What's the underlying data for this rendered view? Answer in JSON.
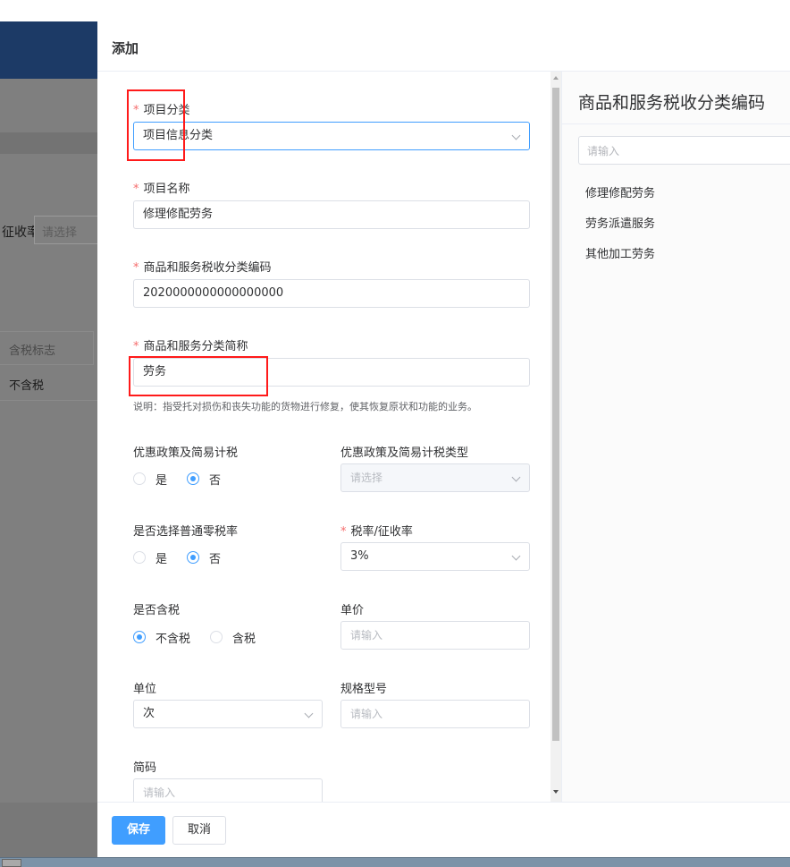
{
  "background": {
    "rate_label": "征收率",
    "rate_placeholder": "请选择",
    "table_header": "含税标志",
    "table_cell": "不含税"
  },
  "drawer": {
    "title": "添加",
    "form": {
      "category": {
        "label": "项目分类",
        "value": "项目信息分类"
      },
      "name": {
        "label": "项目名称",
        "value": "修理修配劳务"
      },
      "tax_code": {
        "label": "商品和服务税收分类编码",
        "value": "2020000000000000000"
      },
      "short_name": {
        "label": "商品和服务分类简称",
        "value": "劳务",
        "hint": "说明：指受托对损伤和丧失功能的货物进行修复，使其恢复原状和功能的业务。"
      },
      "preferential": {
        "label": "优惠政策及简易计税",
        "yes": "是",
        "no": "否",
        "selected": "否"
      },
      "preferential_type": {
        "label": "优惠政策及简易计税类型",
        "placeholder": "请选择"
      },
      "zero_rate": {
        "label": "是否选择普通零税率",
        "yes": "是",
        "no": "否",
        "selected": "否"
      },
      "tax_rate": {
        "label": "税率/征收率",
        "value": "3%"
      },
      "tax_included": {
        "label": "是否含税",
        "option_excl": "不含税",
        "option_incl": "含税",
        "selected": "不含税"
      },
      "unit_price": {
        "label": "单价",
        "placeholder": "请输入"
      },
      "unit": {
        "label": "单位",
        "value": "次"
      },
      "spec": {
        "label": "规格型号",
        "placeholder": "请输入"
      },
      "short_code": {
        "label": "简码",
        "placeholder": "请输入"
      }
    },
    "tree": {
      "title": "商品和服务税收分类编码",
      "search_placeholder": "请输入",
      "items": [
        "修理修配劳务",
        "劳务派遣服务",
        "其他加工劳务"
      ]
    },
    "footer": {
      "save": "保存",
      "cancel": "取消"
    }
  },
  "colors": {
    "primary": "#409eff",
    "required": "#f56c6c",
    "annotation": "#ff1a1a"
  }
}
